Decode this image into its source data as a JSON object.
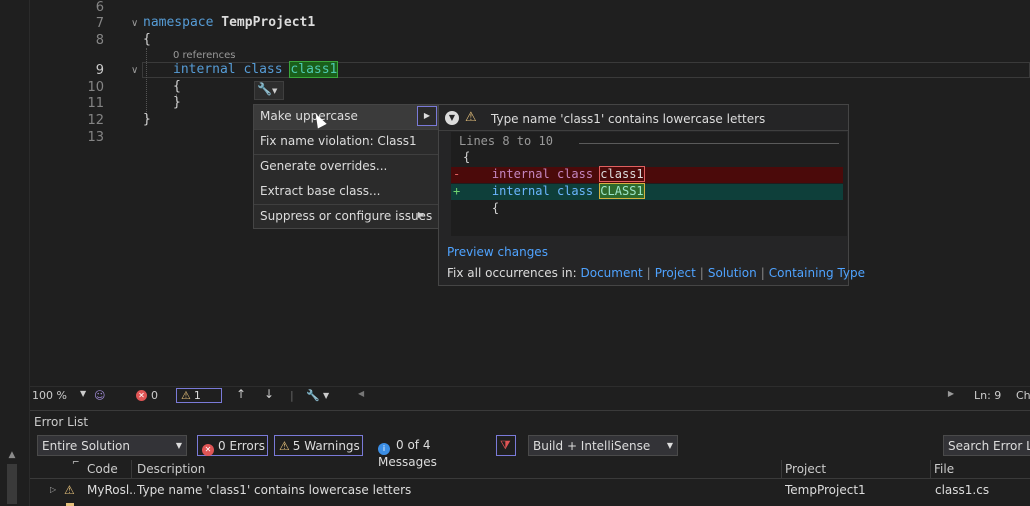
{
  "editor": {
    "lines": [
      {
        "num": "6"
      },
      {
        "num": "7",
        "kw": "namespace",
        "name": "TempProject1"
      },
      {
        "num": "8",
        "text": "{"
      },
      {
        "num": "9",
        "kw1": "internal",
        "kw2": "class",
        "name": "class1"
      },
      {
        "num": "10",
        "text": "{"
      },
      {
        "num": "11",
        "text": "}"
      },
      {
        "num": "12",
        "text": "}"
      },
      {
        "num": "13"
      }
    ],
    "codelens": "0 references"
  },
  "quick_actions": {
    "items": [
      "Make uppercase",
      "Fix name violation: Class1",
      "Generate overrides...",
      "Extract base class...",
      "Suppress or configure issues"
    ]
  },
  "preview": {
    "title": "Type name 'class1' contains lowercase letters",
    "lines_label": "Lines 8 to 10",
    "open_brace": "{",
    "del_sign": "-",
    "add_sign": "+",
    "kw1": "internal",
    "kw2": "class",
    "old_name": "class1",
    "new_name": "CLASS1",
    "inner_brace": "{",
    "preview_changes": "Preview changes",
    "fix_all_label": "Fix all occurrences in:",
    "scopes": [
      "Document",
      "Project",
      "Solution",
      "Containing Type"
    ]
  },
  "status": {
    "zoom": "100 %",
    "errors": "0",
    "warnings": "1",
    "position": "Ln: 9",
    "col_partial": "Ch"
  },
  "error_list": {
    "title": "Error List",
    "scope": "Entire Solution",
    "errors_btn": "0 Errors",
    "warnings_btn": "5 Warnings",
    "messages_btn": "0 of 4 Messages",
    "build_filter": "Build + IntelliSense",
    "search_placeholder": "Search Error List",
    "columns": {
      "code": "Code",
      "description": "Description",
      "project": "Project",
      "file": "File"
    },
    "rows": [
      {
        "code": "MyRosl...",
        "description": "Type name 'class1' contains lowercase letters",
        "project": "TempProject1",
        "file": "class1.cs"
      }
    ]
  },
  "colors": {
    "accent": "#7a7ad8",
    "link": "#4fa3ff",
    "warning": "#e5c07b",
    "error": "#e05555"
  }
}
